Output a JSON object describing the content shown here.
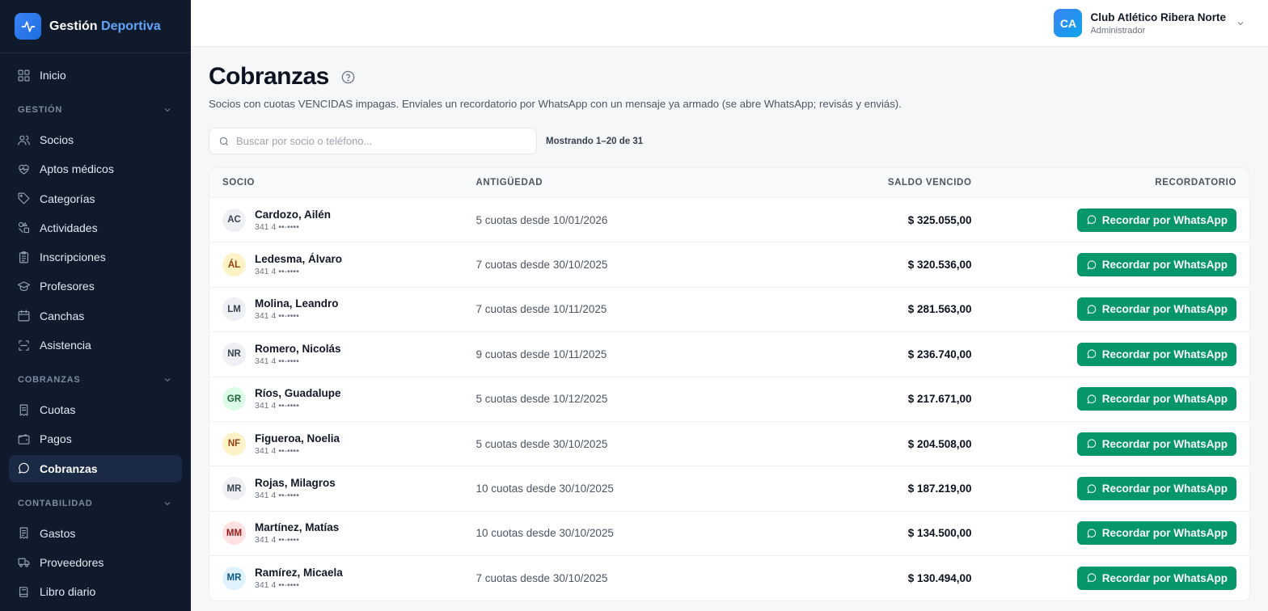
{
  "brand": {
    "name_part1": "Gestión",
    "name_part2": "Deportiva"
  },
  "nav": {
    "inicio": "Inicio",
    "sections": [
      {
        "label": "GESTIÓN",
        "items": [
          "Socios",
          "Aptos médicos",
          "Categorías",
          "Actividades",
          "Inscripciones",
          "Profesores",
          "Canchas",
          "Asistencia"
        ]
      },
      {
        "label": "COBRANZAS",
        "items": [
          "Cuotas",
          "Pagos",
          "Cobranzas"
        ]
      },
      {
        "label": "CONTABILIDAD",
        "items": [
          "Gastos",
          "Proveedores",
          "Libro diario"
        ]
      }
    ],
    "active": "Cobranzas"
  },
  "user": {
    "initials": "CA",
    "name": "Club Atlético Ribera Norte",
    "role": "Administrador"
  },
  "page": {
    "title": "Cobranzas",
    "subtitle": "Socios con cuotas VENCIDAS impagas. Enviales un recordatorio por WhatsApp con un mensaje ya armado (se abre WhatsApp; revisás y enviás).",
    "search_placeholder": "Buscar por socio o teléfono...",
    "showing": "Mostrando 1–20 de 31"
  },
  "table": {
    "headers": {
      "socio": "SOCIO",
      "antiguedad": "ANTIGÜEDAD",
      "saldo": "SALDO VENCIDO",
      "recordatorio": "RECORDATORIO"
    },
    "button_label": "Recordar por WhatsApp",
    "rows": [
      {
        "initials": "AC",
        "name": "Cardozo, Ailén",
        "phone": "341 4 ••-••••",
        "antiguedad": "5 cuotas desde 10/01/2026",
        "saldo": "$ 325.055,00",
        "avatar_bg": "#eef0f4",
        "avatar_fg": "#374151"
      },
      {
        "initials": "ÁL",
        "name": "Ledesma, Álvaro",
        "phone": "341 4 ••-••••",
        "antiguedad": "7 cuotas desde 30/10/2025",
        "saldo": "$ 320.536,00",
        "avatar_bg": "#fef3c7",
        "avatar_fg": "#92400e"
      },
      {
        "initials": "LM",
        "name": "Molina, Leandro",
        "phone": "341 4 ••-••••",
        "antiguedad": "7 cuotas desde 10/11/2025",
        "saldo": "$ 281.563,00",
        "avatar_bg": "#eef0f4",
        "avatar_fg": "#374151"
      },
      {
        "initials": "NR",
        "name": "Romero, Nicolás",
        "phone": "341 4 ••-••••",
        "antiguedad": "9 cuotas desde 10/11/2025",
        "saldo": "$ 236.740,00",
        "avatar_bg": "#eef0f4",
        "avatar_fg": "#374151"
      },
      {
        "initials": "GR",
        "name": "Ríos, Guadalupe",
        "phone": "341 4 ••-••••",
        "antiguedad": "5 cuotas desde 10/12/2025",
        "saldo": "$ 217.671,00",
        "avatar_bg": "#dcfce7",
        "avatar_fg": "#166534"
      },
      {
        "initials": "NF",
        "name": "Figueroa, Noelia",
        "phone": "341 4 ••-••••",
        "antiguedad": "5 cuotas desde 30/10/2025",
        "saldo": "$ 204.508,00",
        "avatar_bg": "#fef3c7",
        "avatar_fg": "#92400e"
      },
      {
        "initials": "MR",
        "name": "Rojas, Milagros",
        "phone": "341 4 ••-••••",
        "antiguedad": "10 cuotas desde 30/10/2025",
        "saldo": "$ 187.219,00",
        "avatar_bg": "#eef0f4",
        "avatar_fg": "#374151"
      },
      {
        "initials": "MM",
        "name": "Martínez, Matías",
        "phone": "341 4 ••-••••",
        "antiguedad": "10 cuotas desde 30/10/2025",
        "saldo": "$ 134.500,00",
        "avatar_bg": "#fee2e2",
        "avatar_fg": "#991b1b"
      },
      {
        "initials": "MR",
        "name": "Ramírez, Micaela",
        "phone": "341 4 ••-••••",
        "antiguedad": "7 cuotas desde 30/10/2025",
        "saldo": "$ 130.494,00",
        "avatar_bg": "#e0f2fe",
        "avatar_fg": "#075985"
      }
    ]
  }
}
